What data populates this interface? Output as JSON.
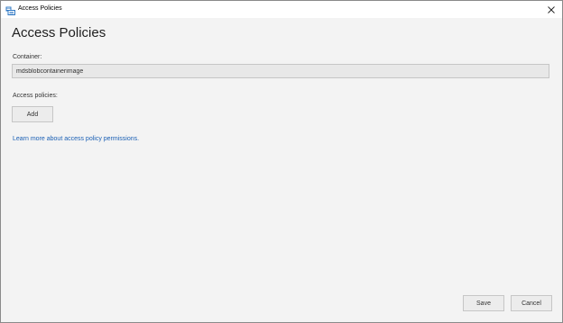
{
  "window": {
    "title": "Access Policies",
    "icon": "storage-explorer-app-icon",
    "close_icon": "close-icon"
  },
  "page": {
    "title": "Access Policies"
  },
  "container": {
    "label": "Container:",
    "value": "mdsblobcontainerimage"
  },
  "policies": {
    "label": "Access policies:",
    "add_label": "Add"
  },
  "learn_more": {
    "text": "Learn more about access policy permissions."
  },
  "footer": {
    "save_label": "Save",
    "cancel_label": "Cancel"
  },
  "colors": {
    "background": "#f3f3f3",
    "link": "#1a5fb4",
    "button_bg": "#ececec",
    "button_border": "#c6c6c6"
  }
}
